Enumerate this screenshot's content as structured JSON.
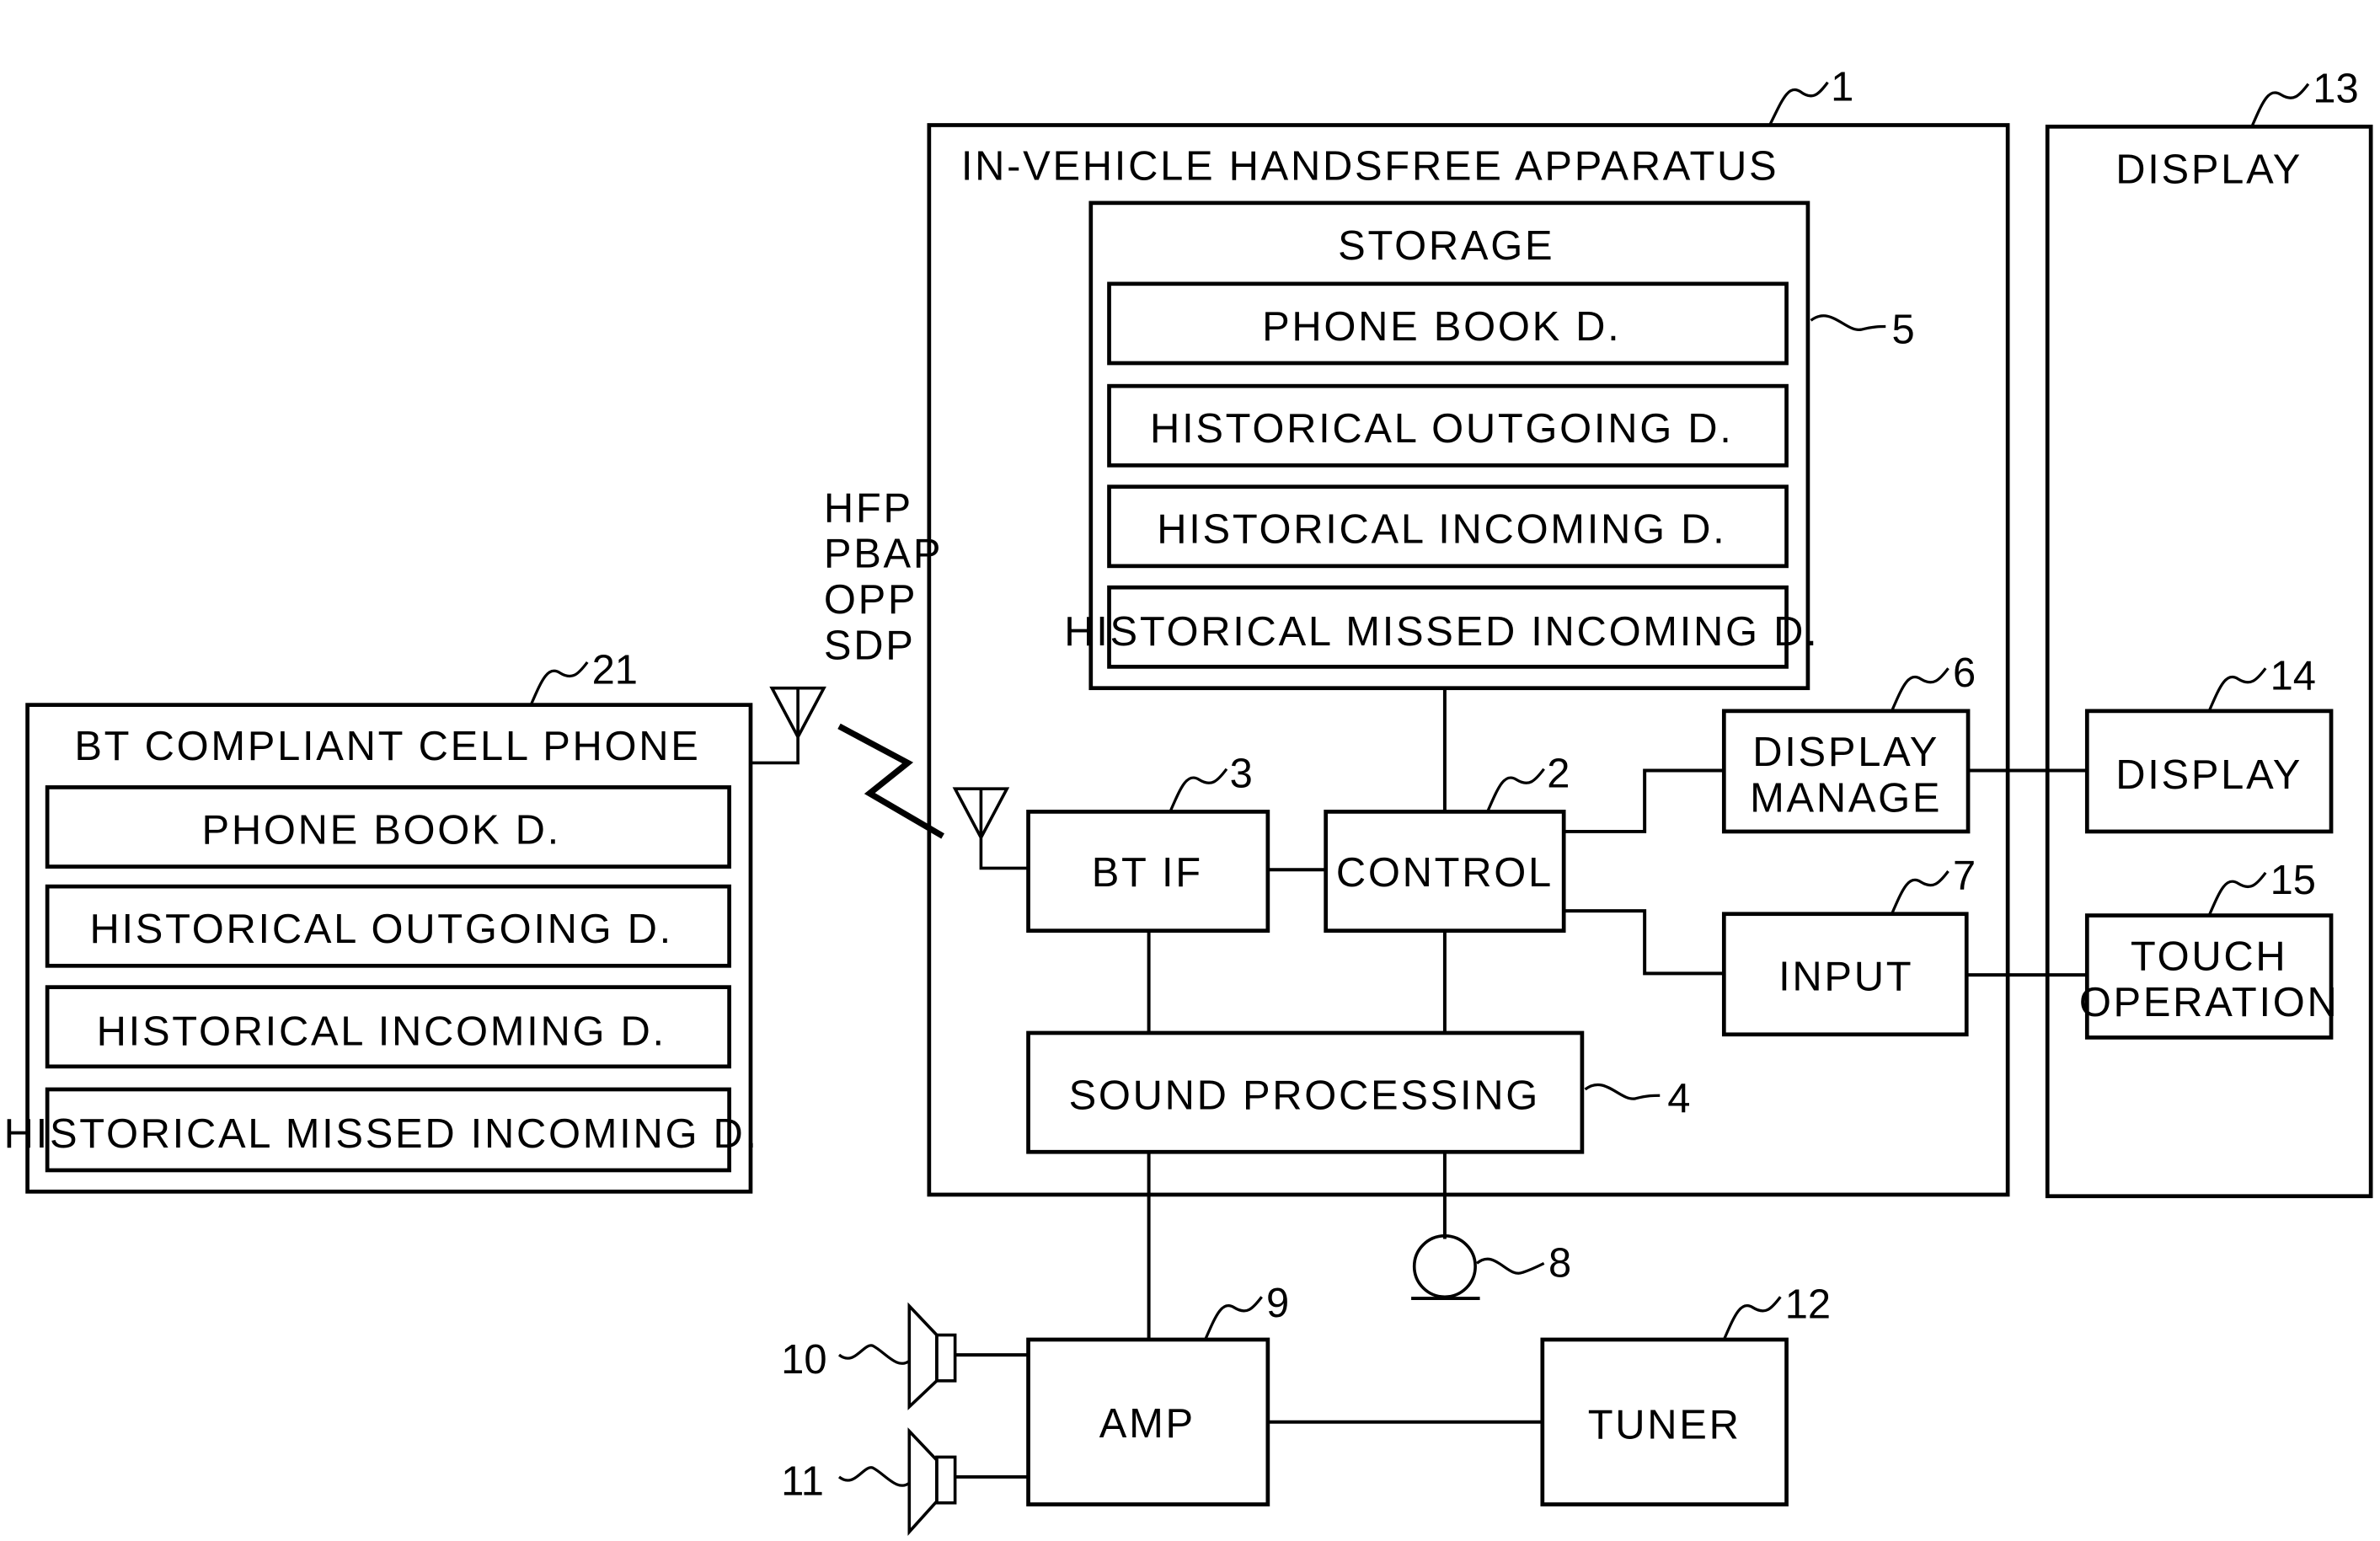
{
  "title": "In-vehicle handsfree apparatus block diagram",
  "apparatus": {
    "ref": "1",
    "label": "IN-VEHICLE HANDSFREE APPARATUS",
    "storage": {
      "ref": "5",
      "label": "STORAGE",
      "items": [
        "PHONE BOOK D.",
        "HISTORICAL OUTGOING D.",
        "HISTORICAL INCOMING D.",
        "HISTORICAL MISSED INCOMING D."
      ]
    },
    "control": {
      "ref": "2",
      "label": "CONTROL"
    },
    "bt_if": {
      "ref": "3",
      "label": "BT IF"
    },
    "sound_processing": {
      "ref": "4",
      "label": "SOUND PROCESSING"
    },
    "display_manage": {
      "ref": "6",
      "line1": "DISPLAY",
      "line2": "MANAGE"
    },
    "input": {
      "ref": "7",
      "label": "INPUT"
    }
  },
  "display_unit": {
    "ref": "13",
    "label": "DISPLAY",
    "display": {
      "ref": "14",
      "label": "DISPLAY"
    },
    "touch": {
      "ref": "15",
      "line1": "TOUCH",
      "line2": "OPERATION"
    }
  },
  "cell_phone": {
    "ref": "21",
    "label": "BT COMPLIANT CELL PHONE",
    "items": [
      "PHONE BOOK D.",
      "HISTORICAL OUTGOING D.",
      "HISTORICAL INCOMING D.",
      "HISTORICAL MISSED INCOMING D."
    ]
  },
  "protocols": [
    "HFP",
    "PBAP",
    "OPP",
    "SDP"
  ],
  "microphone": {
    "ref": "8"
  },
  "amp": {
    "ref": "9",
    "label": "AMP"
  },
  "speakers": [
    {
      "ref": "10"
    },
    {
      "ref": "11"
    }
  ],
  "tuner": {
    "ref": "12",
    "label": "TUNER"
  }
}
